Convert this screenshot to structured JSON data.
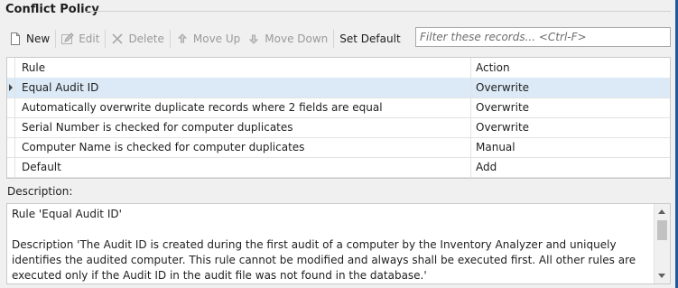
{
  "panel": {
    "title": "Conflict Policy"
  },
  "toolbar": {
    "new_label": "New",
    "edit_label": "Edit",
    "delete_label": "Delete",
    "move_up_label": "Move Up",
    "move_down_label": "Move Down",
    "set_default_label": "Set Default"
  },
  "filter": {
    "placeholder": "Filter these records... <Ctrl-F>"
  },
  "grid": {
    "columns": [
      "Rule",
      "Action"
    ],
    "rows": [
      {
        "rule": "Equal Audit ID",
        "action": "Overwrite",
        "selected": true
      },
      {
        "rule": "Automatically overwrite duplicate records where 2 fields are equal",
        "action": "Overwrite"
      },
      {
        "rule": "Serial Number is checked for computer duplicates",
        "action": "Overwrite"
      },
      {
        "rule": "Computer Name is checked for computer duplicates",
        "action": "Manual"
      },
      {
        "rule": "Default",
        "action": "Add"
      }
    ]
  },
  "description": {
    "label": "Description:",
    "text": "Rule 'Equal Audit ID'\n\nDescription 'The Audit ID is created during the first audit of a computer by the Inventory Analyzer and uniquely identifies the audited computer. This rule cannot be modified and always shall be executed first. All other rules are executed only if the Audit ID in the audit file was not found in the database.'"
  },
  "icons": [
    "new-document-icon",
    "edit-icon",
    "delete-icon",
    "arrow-up-icon",
    "arrow-down-icon",
    "row-pointer-icon"
  ],
  "colors": {
    "selected_row": "#dceaf7",
    "accent_edge": "#1e5aa0"
  }
}
